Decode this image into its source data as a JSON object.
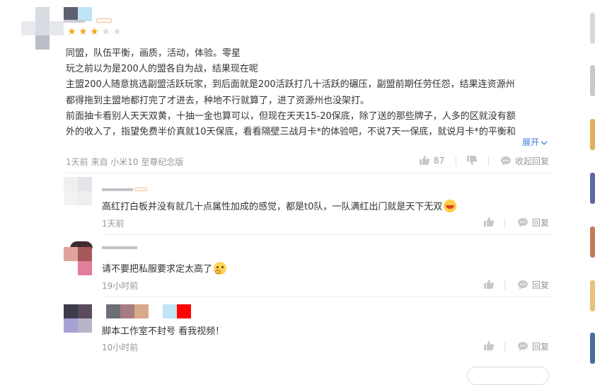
{
  "main_review": {
    "rating": 3,
    "max_rating": 5,
    "lines": [
      "同盟，队伍平衡，画质，活动，体验。零星",
      "玩之前以为是200人的盟各自为战，结果现在呢",
      "主盟200人随意挑选副盟活跃玩家，到后面就是200活跃打几十活跃的碾压，副盟前期任劳任怨，结果连资源州",
      "都得拖到主盟地都打完了才进去，种地不行就算了，进了资源州也没架打。",
      "前面抽卡看别人天天双黄，十抽一金也算可以，但现在天天15-20保底，除了送的那些牌子，人多的区就没有额",
      "外的收入了，指望免费半价真就10天保底，看看隔壁三战月卡*的体验吧，不说7天一保底，就说月卡*的平衡和"
    ],
    "expand_label": "展开",
    "meta": "1天前 来自 小米10 至尊纪念版",
    "like_count": "87",
    "fold_reply_label": "收起回复"
  },
  "replies": [
    {
      "text": "高红打白板并没有就几十点属性加成的感觉，都是t0队，一队满红出门就是天下无双",
      "time": "1天前",
      "reply_label": "回复"
    },
    {
      "text": "请不要把私服要求定太高了",
      "time": "19小时前",
      "reply_label": "回复"
    },
    {
      "text": "脚本工作室不封号 看我视频！",
      "time": "10小时前",
      "reply_label": "回复"
    }
  ],
  "colors": {
    "star_on": "#f5a623",
    "star_off": "#dcdcdc",
    "link": "#3a7bd5",
    "meta": "#999999"
  }
}
